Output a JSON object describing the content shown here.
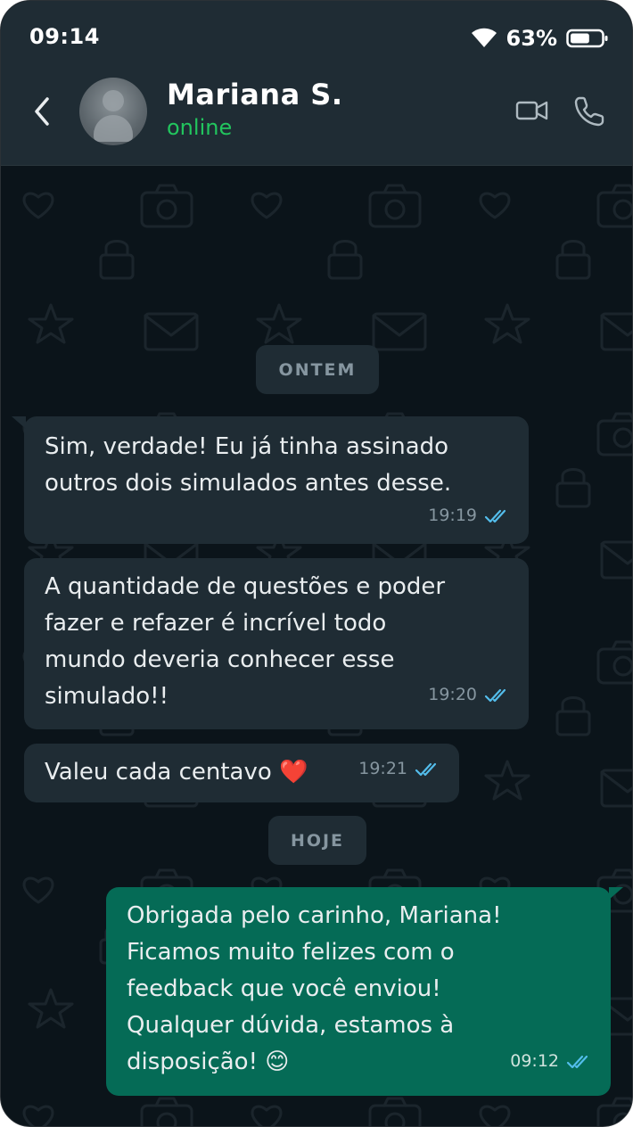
{
  "status_bar": {
    "time": "09:14",
    "battery_percent": "63%",
    "battery_level": 0.63
  },
  "header": {
    "contact_name": "Mariana S.",
    "contact_status": "online"
  },
  "chat": {
    "date_separators": [
      "ONTEM",
      "HOJE"
    ],
    "messages": [
      {
        "direction": "incoming",
        "text": "Sim, verdade! Eu já tinha assinado\noutros dois simulados antes desse.",
        "time": "19:19",
        "read": true
      },
      {
        "direction": "incoming",
        "text": "A quantidade de questões e poder\nfazer e refazer é incrível todo\nmundo deveria conhecer esse\nsimulado!!",
        "time": "19:20",
        "read": true
      },
      {
        "direction": "incoming",
        "text": "Valeu cada centavo ❤️",
        "time": "19:21",
        "read": true
      },
      {
        "direction": "outgoing",
        "text": "Obrigada pelo carinho, Mariana!\nFicamos muito felizes com o\nfeedback que você enviou!\nQualquer dúvida, estamos à\ndisposição! 😊",
        "time": "09:12",
        "read": true
      }
    ]
  },
  "icons": [
    "back-icon",
    "wifi-icon",
    "battery-icon",
    "avatar-placeholder",
    "video-call-icon",
    "phone-call-icon",
    "double-check-icon"
  ],
  "colors": {
    "header_bg": "#1f2c34",
    "chat_bg": "#0b141a",
    "incoming_bubble": "#1f2c34",
    "outgoing_bubble": "#056b56",
    "online_green": "#22c55e",
    "read_check": "#53bdeb"
  }
}
